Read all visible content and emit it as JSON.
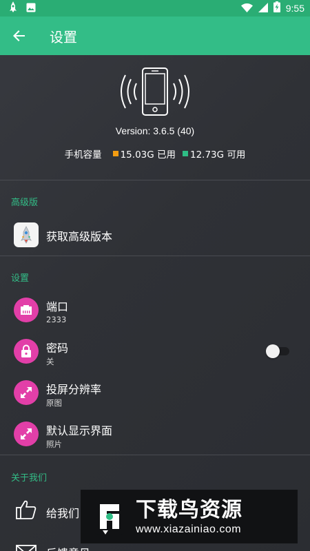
{
  "status_bar": {
    "time": "9:55",
    "icons_left": [
      "app-rocket-icon",
      "image-icon"
    ],
    "icons_right": [
      "wifi-icon",
      "signal-icon",
      "battery-charging-icon"
    ]
  },
  "app_bar": {
    "title": "设置",
    "back_icon": "arrow-left-icon"
  },
  "header": {
    "version": "Version: 3.6.5 (40)",
    "storage_label": "手机容量",
    "used": "15.03G 已用",
    "available": "12.73G 可用"
  },
  "premium": {
    "section_title": "高级版",
    "item_label": "获取高级版本"
  },
  "settings": {
    "section_title": "设置",
    "items": [
      {
        "title": "端口",
        "subtitle": "2333",
        "icon": "ethernet-port-icon"
      },
      {
        "title": "密码",
        "subtitle": "关",
        "icon": "lock-icon",
        "toggle": false
      },
      {
        "title": "投屏分辨率",
        "subtitle": "原图",
        "icon": "expand-arrows-icon"
      },
      {
        "title": "默认显示界面",
        "subtitle": "照片",
        "icon": "expand-arrows-icon"
      }
    ]
  },
  "about": {
    "section_title": "关于我们",
    "items": [
      {
        "title": "给我们",
        "icon": "thumbs-up-icon"
      },
      {
        "title": "反馈意见",
        "icon": "mail-icon"
      }
    ]
  },
  "watermark": {
    "title": "下载鸟资源",
    "url": "www.xiazainiao.com"
  },
  "colors": {
    "status_bar": "#2aad74",
    "app_bar": "#33bd87",
    "accent": "#33bd87",
    "icon_circle": "#e23fa8",
    "used": "#f39c12",
    "available": "#2ebd85",
    "background": "#2f3136"
  }
}
